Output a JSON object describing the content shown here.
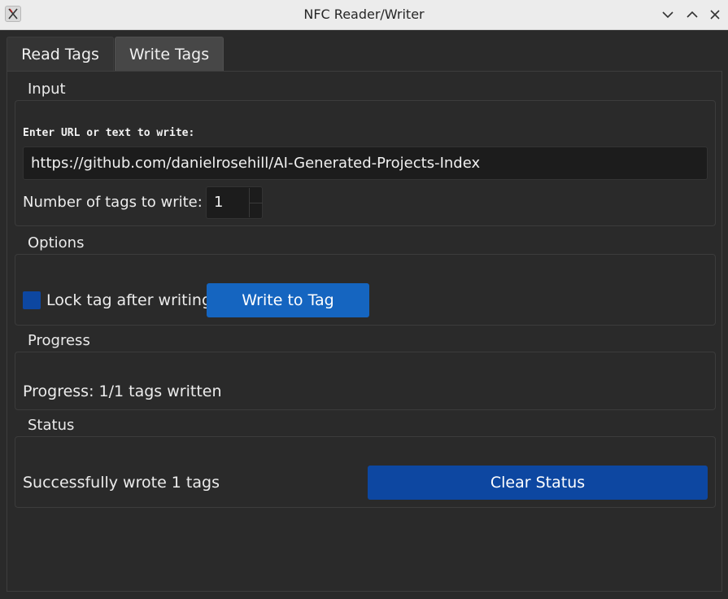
{
  "window": {
    "title": "NFC Reader/Writer"
  },
  "tabs": [
    {
      "label": "Read Tags",
      "active": false
    },
    {
      "label": "Write Tags",
      "active": true
    }
  ],
  "input_group": {
    "title": "Input",
    "url_label": "Enter URL or text to write:",
    "url_value": "https://github.com/danielrosehill/AI-Generated-Projects-Index",
    "tags_count_label": "Number of tags to write:",
    "tags_count_value": "1"
  },
  "options_group": {
    "title": "Options",
    "lock_label": "Lock tag after writing",
    "lock_checked": true,
    "write_button": "Write to Tag"
  },
  "progress_group": {
    "title": "Progress",
    "text": "Progress: 1/1 tags written",
    "written": 1,
    "total": 1
  },
  "status_group": {
    "title": "Status",
    "text": "Successfully wrote 1 tags",
    "clear_button": "Clear Status"
  },
  "colors": {
    "accent": "#1565c0",
    "accent_dark": "#0d47a1",
    "background": "#2a2a2a",
    "titlebar": "#ececec"
  },
  "icons": {
    "app": "app-icon",
    "minimize": "chevron-down-icon",
    "maximize": "chevron-up-icon",
    "close": "close-icon"
  }
}
